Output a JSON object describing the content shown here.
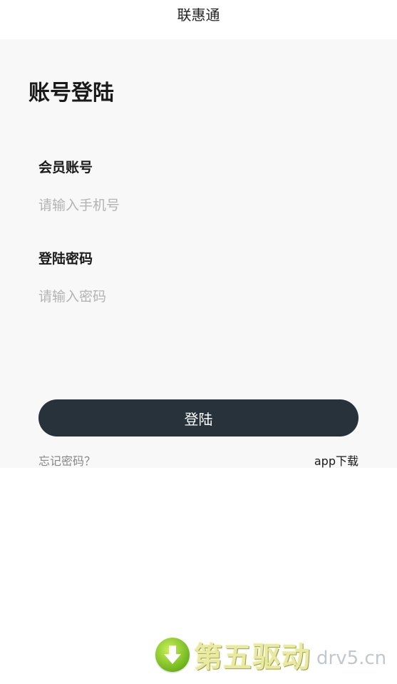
{
  "header": {
    "title": "联惠通"
  },
  "login": {
    "heading": "账号登陆",
    "account_label": "会员账号",
    "account_placeholder": "请输入手机号",
    "password_label": "登陆密码",
    "password_placeholder": "请输入密码",
    "submit_label": "登陆",
    "forgot_label": "忘记密码？",
    "download_label": "app下载"
  },
  "watermark": {
    "brand": "第五驱动",
    "domain": "drv5.cn",
    "icon": "download-arrow-icon"
  },
  "colors": {
    "button_bg": "#27323b",
    "content_bg": "#f8f8f8",
    "placeholder": "#b3b3b3"
  }
}
